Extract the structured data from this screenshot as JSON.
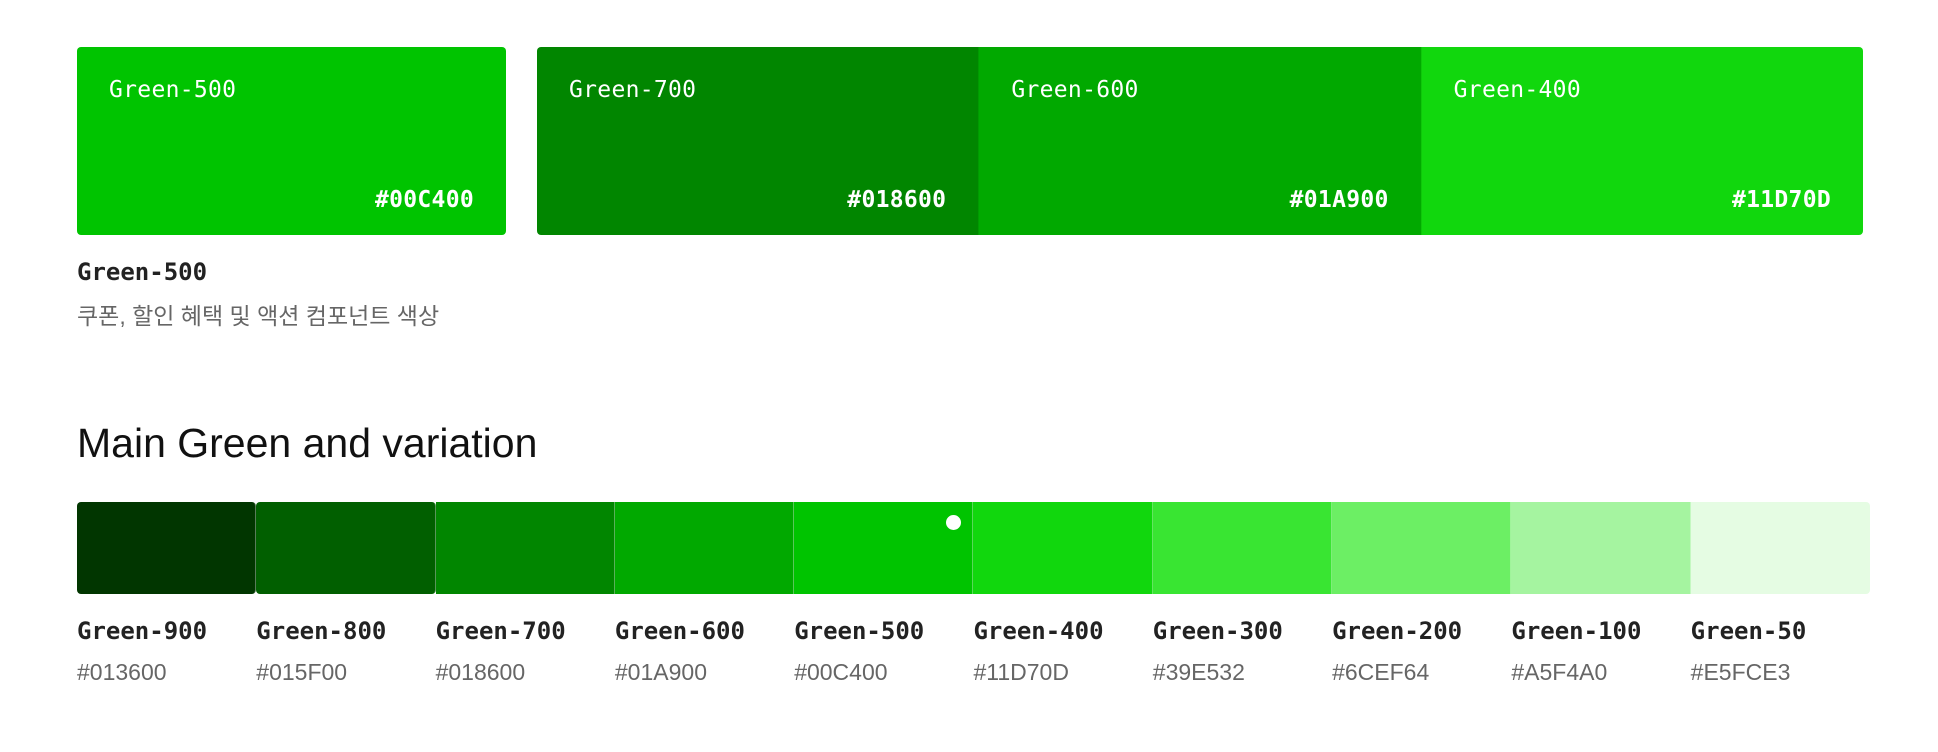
{
  "primary": {
    "name": "Green-500",
    "hex": "#00C400",
    "color": "#00C400",
    "title": "Green-500",
    "description": "쿠폰, 할인 혜택 및 액션 컴포넌트 색상"
  },
  "group": [
    {
      "name": "Green-700",
      "hex": "#018600",
      "color": "#018600"
    },
    {
      "name": "Green-600",
      "hex": "#01A900",
      "color": "#01A900"
    },
    {
      "name": "Green-400",
      "hex": "#11D70D",
      "color": "#11D70D"
    }
  ],
  "section": {
    "title": "Main Green and variation"
  },
  "scale": [
    {
      "name": "Green-900",
      "hex": "#013600",
      "color": "#013600"
    },
    {
      "name": "Green-800",
      "hex": "#015F00",
      "color": "#015F00"
    },
    {
      "name": "Green-700",
      "hex": "#018600",
      "color": "#018600"
    },
    {
      "name": "Green-600",
      "hex": "#01A900",
      "color": "#01A900"
    },
    {
      "name": "Green-500",
      "hex": "#00C400",
      "color": "#00C400",
      "selected": true
    },
    {
      "name": "Green-400",
      "hex": "#11D70D",
      "color": "#11D70D"
    },
    {
      "name": "Green-300",
      "hex": "#39E532",
      "color": "#39E532"
    },
    {
      "name": "Green-200",
      "hex": "#6CEF64",
      "color": "#6CEF64"
    },
    {
      "name": "Green-100",
      "hex": "#A5F4A0",
      "color": "#A5F4A0"
    },
    {
      "name": "Green-50",
      "hex": "#E5FCE3",
      "color": "#E5FCE3"
    }
  ]
}
